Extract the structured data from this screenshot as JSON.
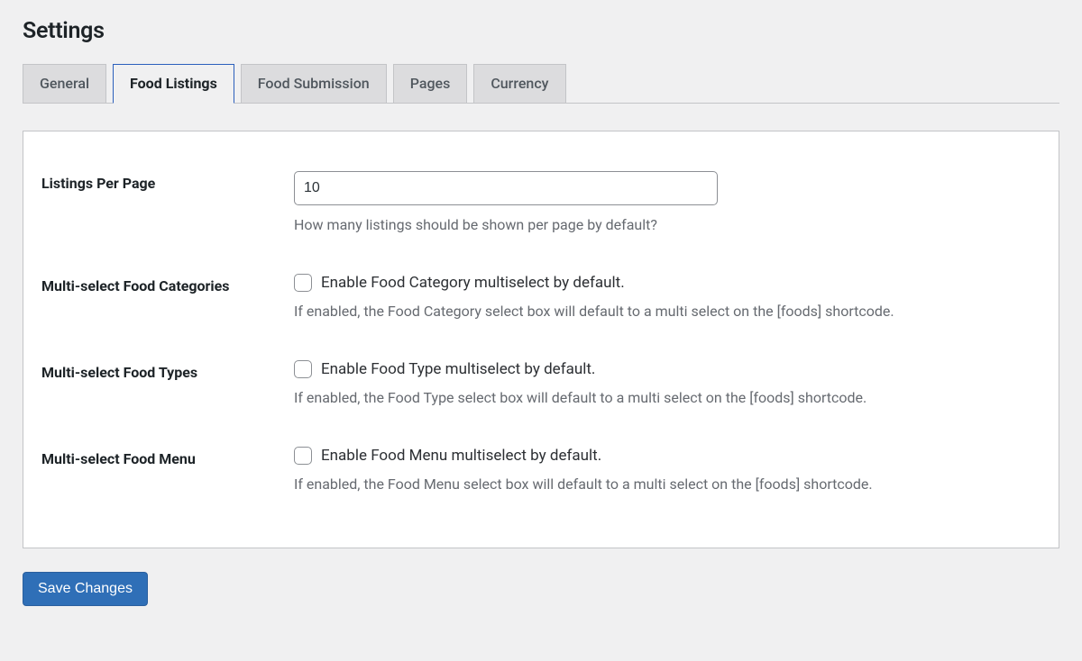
{
  "page_title": "Settings",
  "tabs": {
    "general": "General",
    "food_listings": "Food Listings",
    "food_submission": "Food Submission",
    "pages": "Pages",
    "currency": "Currency"
  },
  "active_tab": "food_listings",
  "fields": {
    "listings_per_page": {
      "label": "Listings Per Page",
      "value": "10",
      "description": "How many listings should be shown per page by default?"
    },
    "multi_cat": {
      "label": "Multi-select Food Categories",
      "checkbox_label": "Enable Food Category multiselect by default.",
      "description": "If enabled, the Food Category select box will default to a multi select on the [foods] shortcode."
    },
    "multi_type": {
      "label": "Multi-select Food Types",
      "checkbox_label": "Enable Food Type multiselect by default.",
      "description": "If enabled, the Food Type select box will default to a multi select on the [foods] shortcode."
    },
    "multi_menu": {
      "label": "Multi-select Food Menu",
      "checkbox_label": "Enable Food Menu multiselect by default.",
      "description": "If enabled, the Food Menu select box will default to a multi select on the [foods] shortcode."
    }
  },
  "save_button": "Save Changes"
}
